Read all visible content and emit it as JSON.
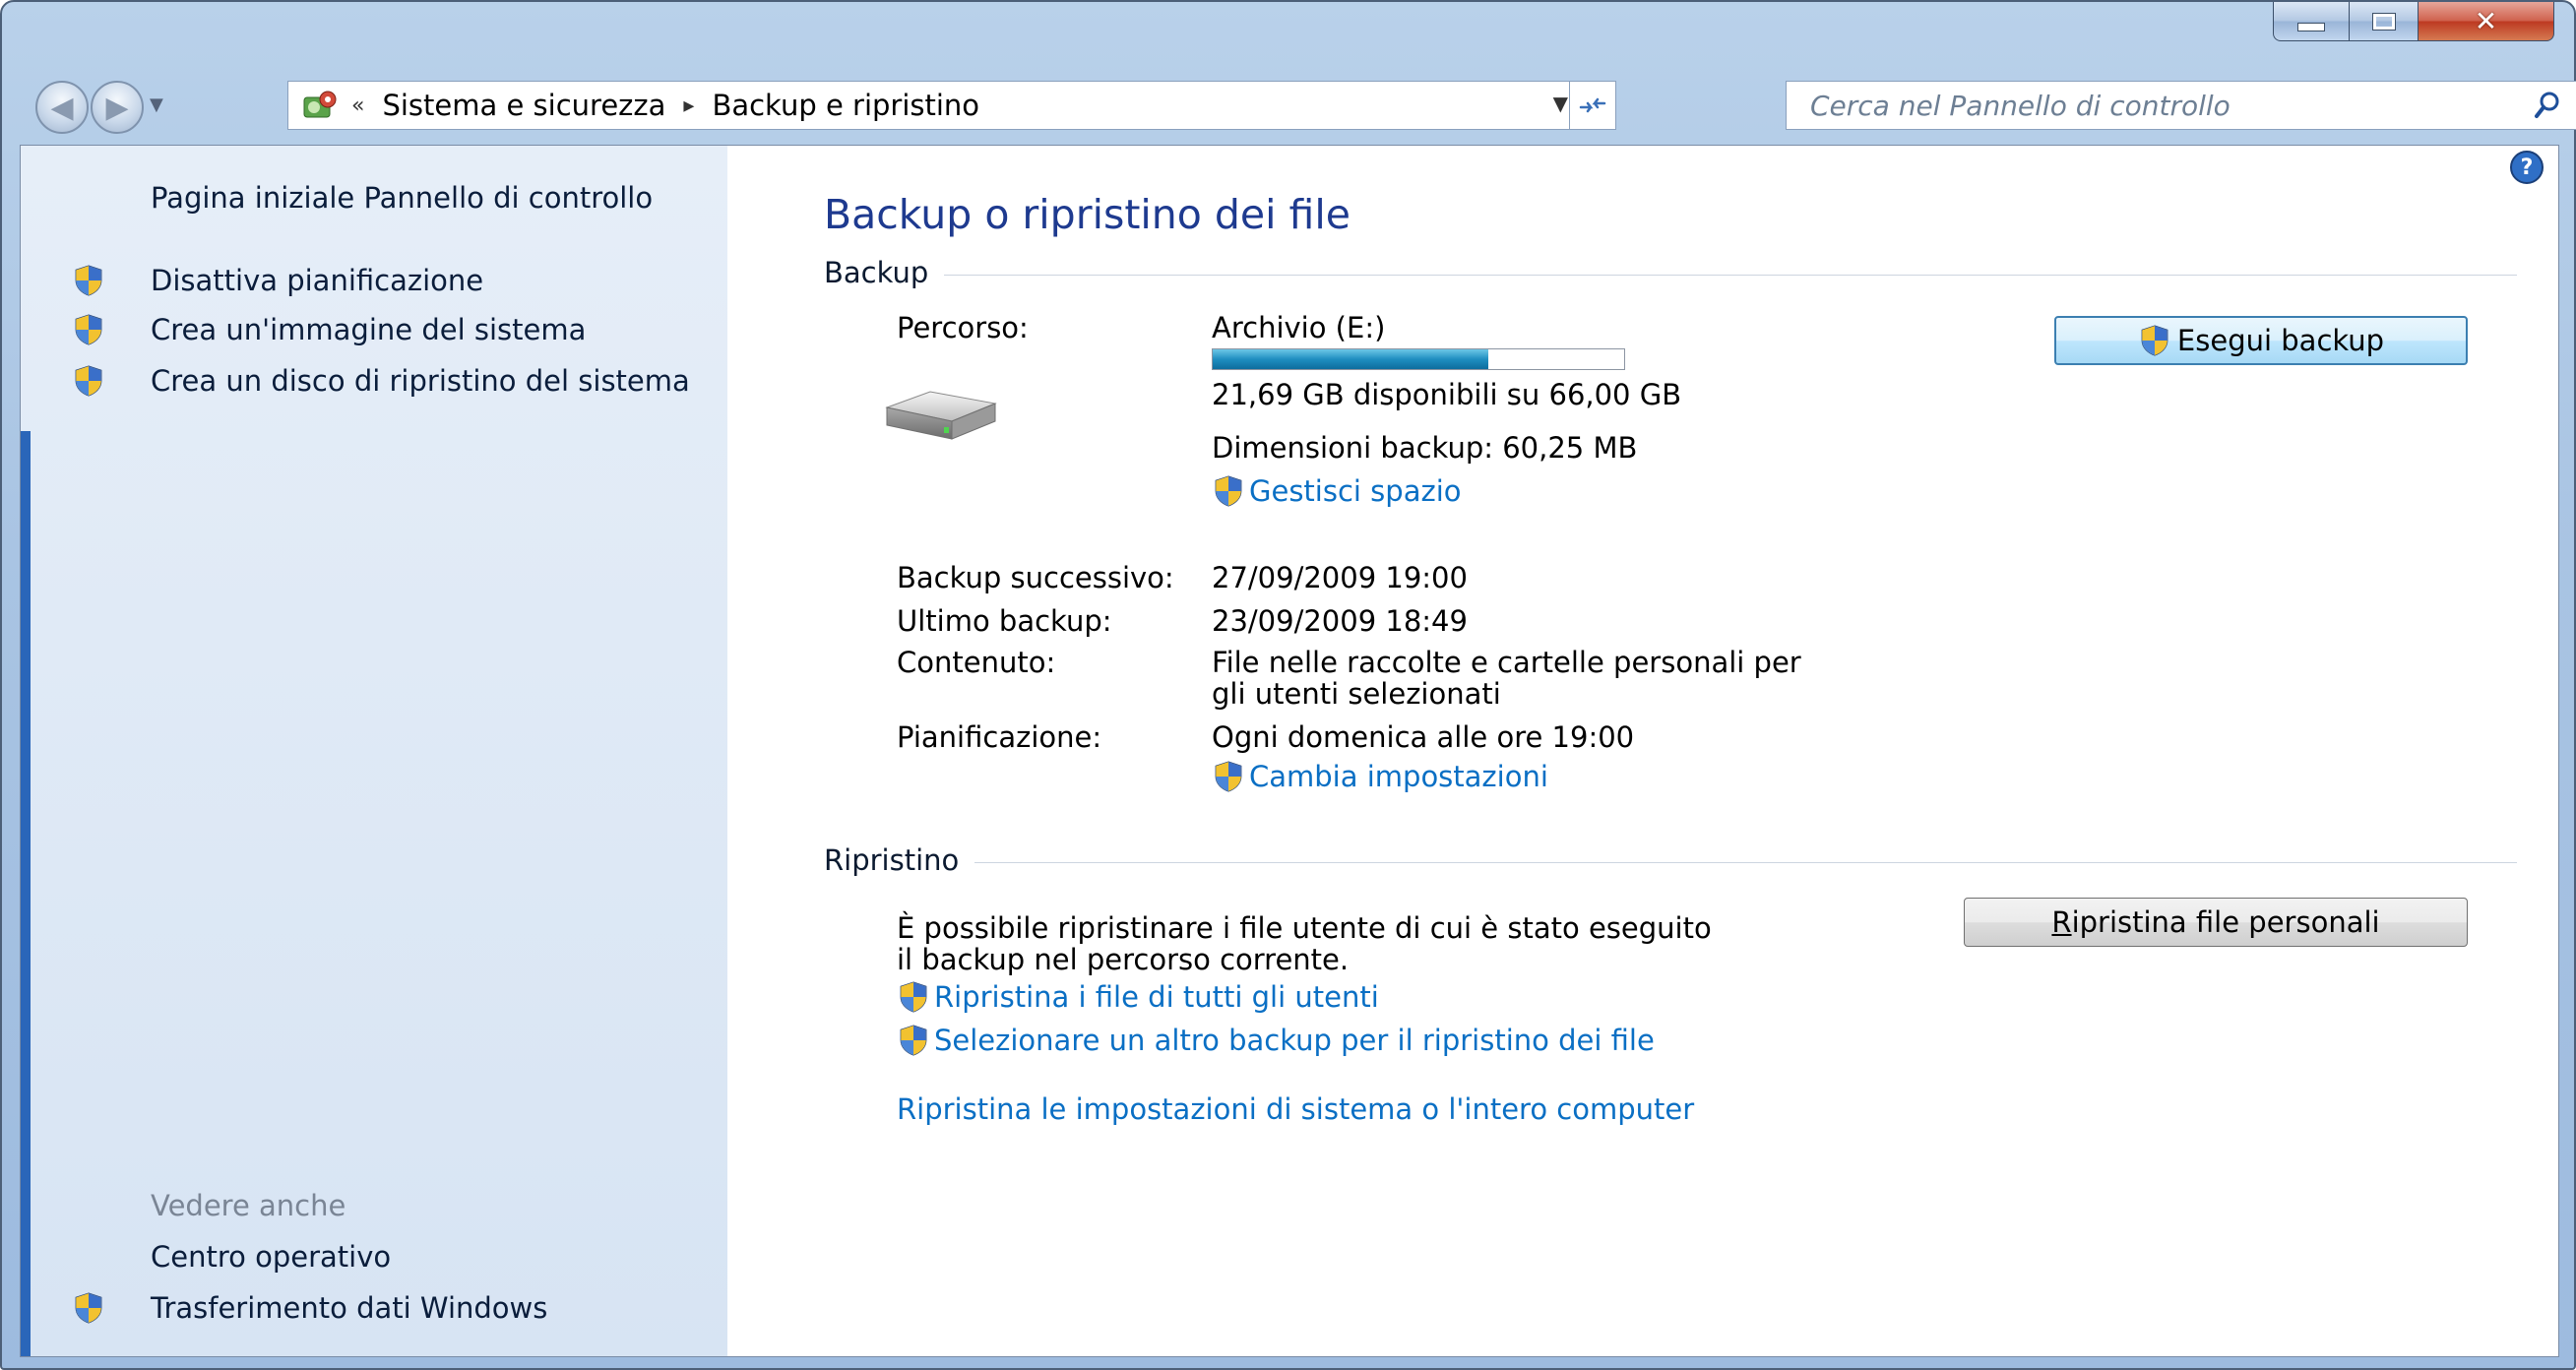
{
  "window": {
    "caption_buttons": {
      "minimize_icon": "minimize-icon",
      "maximize_icon": "maximize-icon",
      "close_icon": "close-icon"
    }
  },
  "address_bar": {
    "overflow_chevron": "«",
    "crumbs": [
      "Sistema e sicurezza",
      "Backup e ripristino"
    ],
    "separator": "▸"
  },
  "search": {
    "placeholder": "Cerca nel Pannello di controllo"
  },
  "left_pane": {
    "home_link": "Pagina iniziale Pannello di controllo",
    "tasks": [
      {
        "label": "Disattiva pianificazione",
        "icon": "uac-shield-icon"
      },
      {
        "label": "Crea un'immagine del sistema",
        "icon": "uac-shield-icon"
      },
      {
        "label": "Crea un disco di ripristino del sistema",
        "icon": "uac-shield-icon"
      }
    ],
    "see_also_heading": "Vedere anche",
    "see_also": [
      {
        "label": "Centro operativo"
      },
      {
        "label": "Trasferimento dati Windows",
        "icon": "uac-shield-icon"
      }
    ]
  },
  "main": {
    "title": "Backup o ripristino dei file",
    "backup": {
      "section_label": "Backup",
      "location_label": "Percorso:",
      "location_value": "Archivio (E:)",
      "drive_usage_fraction": 0.67,
      "free_space": "21,69 GB disponibili su 66,00 GB",
      "backup_size": "Dimensioni backup: 60,25 MB",
      "manage_space_link": "Gestisci spazio",
      "run_backup_button": "Esegui backup",
      "next_backup_label": "Backup successivo:",
      "next_backup_value": "27/09/2009 19:00",
      "last_backup_label": "Ultimo backup:",
      "last_backup_value": "23/09/2009 18:49",
      "contents_label": "Contenuto:",
      "contents_value_line1": "File nelle raccolte e cartelle personali per",
      "contents_value_line2": "gli utenti selezionati",
      "schedule_label": "Pianificazione:",
      "schedule_value": "Ogni domenica alle ore 19:00",
      "change_settings_link": "Cambia impostazioni"
    },
    "restore": {
      "section_label": "Ripristino",
      "description_line1": "È possibile ripristinare i file utente di cui è stato eseguito",
      "description_line2": "il backup nel percorso corrente.",
      "restore_my_files_button_first_letter": "R",
      "restore_my_files_button_rest": "ipristina file personali",
      "restore_all_users_link": "Ripristina i file di tutti gli utenti",
      "select_other_backup_link": "Selezionare un altro backup per il ripristino dei file",
      "recover_system_link": "Ripristina le impostazioni di sistema o l'intero computer"
    }
  },
  "colors": {
    "link": "#0a6fc4",
    "title": "#1e3a8f",
    "left_pane_bg": "#dfe9f5",
    "progress_fill": "#1f8ec0"
  }
}
